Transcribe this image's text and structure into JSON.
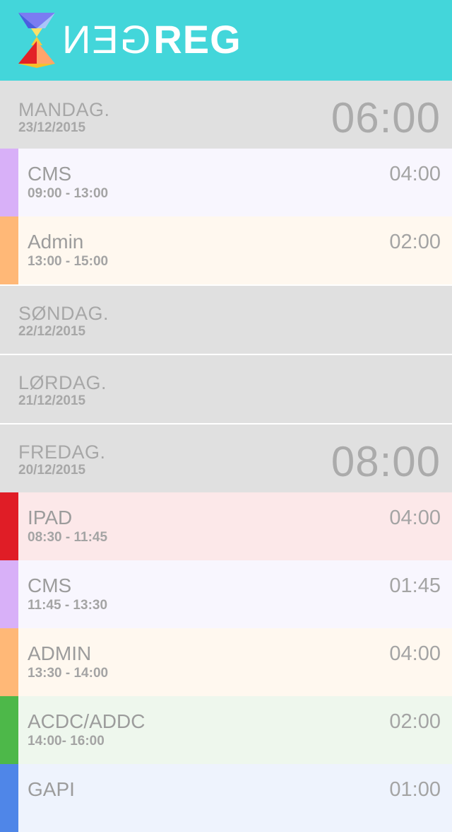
{
  "app": {
    "logo_mirrored_text": "GEN",
    "logo_bold_text": "REG",
    "header_color": "#43d6da"
  },
  "days": [
    {
      "name": "MANDAG.",
      "date": "23/12/2015",
      "total": "06:00",
      "entries": [
        {
          "label": "CMS",
          "range": "09:00 - 13:00",
          "duration": "04:00",
          "color": "#d8b0f8",
          "bg": "#f8f6fe"
        },
        {
          "label": "Admin",
          "range": "13:00 - 15:00",
          "duration": "02:00",
          "color": "#ffb877",
          "bg": "#fff8ef"
        }
      ]
    },
    {
      "name": "SØNDAG.",
      "date": "22/12/2015",
      "total": "",
      "entries": []
    },
    {
      "name": "LØRDAG.",
      "date": "21/12/2015",
      "total": "",
      "entries": []
    },
    {
      "name": "FREDAG.",
      "date": "20/12/2015",
      "total": "08:00",
      "entries": [
        {
          "label": "IPAD",
          "range": "08:30 - 11:45",
          "duration": "04:00",
          "color": "#e01d26",
          "bg": "#fce8e9"
        },
        {
          "label": "CMS",
          "range": "11:45 - 13:30",
          "duration": "01:45",
          "color": "#d8b0f8",
          "bg": "#f8f6fe"
        },
        {
          "label": "ADMIN",
          "range": "13:30 - 14:00",
          "duration": "04:00",
          "color": "#ffb877",
          "bg": "#fff8ef"
        },
        {
          "label": "ACDC/ADDC",
          "range": "14:00- 16:00",
          "duration": "02:00",
          "color": "#4db849",
          "bg": "#eef7ed"
        },
        {
          "label": "GAPI",
          "range": "",
          "duration": "01:00",
          "color": "#4f86e8",
          "bg": "#eef3fd"
        }
      ]
    }
  ]
}
